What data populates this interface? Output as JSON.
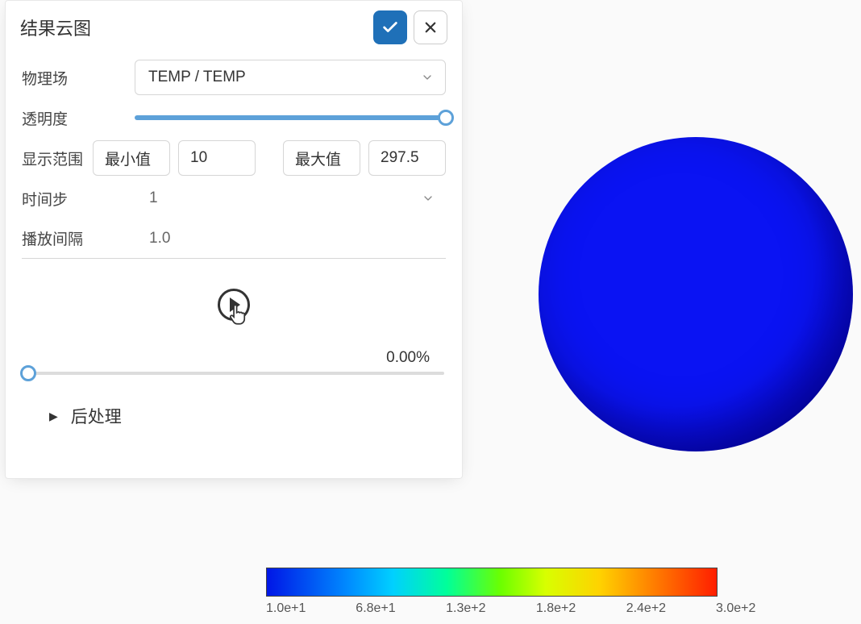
{
  "panel": {
    "title": "结果云图",
    "rows": {
      "field_label": "物理场",
      "transparency_label": "透明度",
      "range_label": "显示范围",
      "min_label": "最小值",
      "max_label": "最大值",
      "timestep_label": "时间步",
      "interval_label": "播放间隔"
    },
    "field_select": "TEMP / TEMP",
    "transparency_pct": 100,
    "min_value": "10",
    "max_value": "297.5",
    "timestep_value": "1",
    "interval_value": "1.0",
    "progress_text": "0.00%",
    "tree_item": "后处理"
  },
  "colorbar": {
    "ticks": [
      "1.0e+1",
      "6.8e+1",
      "1.3e+2",
      "1.8e+2",
      "2.4e+2",
      "3.0e+2"
    ]
  },
  "chart_data": {
    "type": "heatmap",
    "title": "结果云图",
    "field": "TEMP / TEMP",
    "value_range": [
      10,
      297.5
    ],
    "colorbar_ticks": [
      10,
      68,
      130,
      180,
      240,
      300
    ],
    "colorbar_tick_labels": [
      "1.0e+1",
      "6.8e+1",
      "1.3e+2",
      "1.8e+2",
      "2.4e+2",
      "3.0e+2"
    ],
    "note": "Spherical model colored uniformly at low end of scale (blue). Colorbar is a linear rainbow gradient from blue to red."
  }
}
